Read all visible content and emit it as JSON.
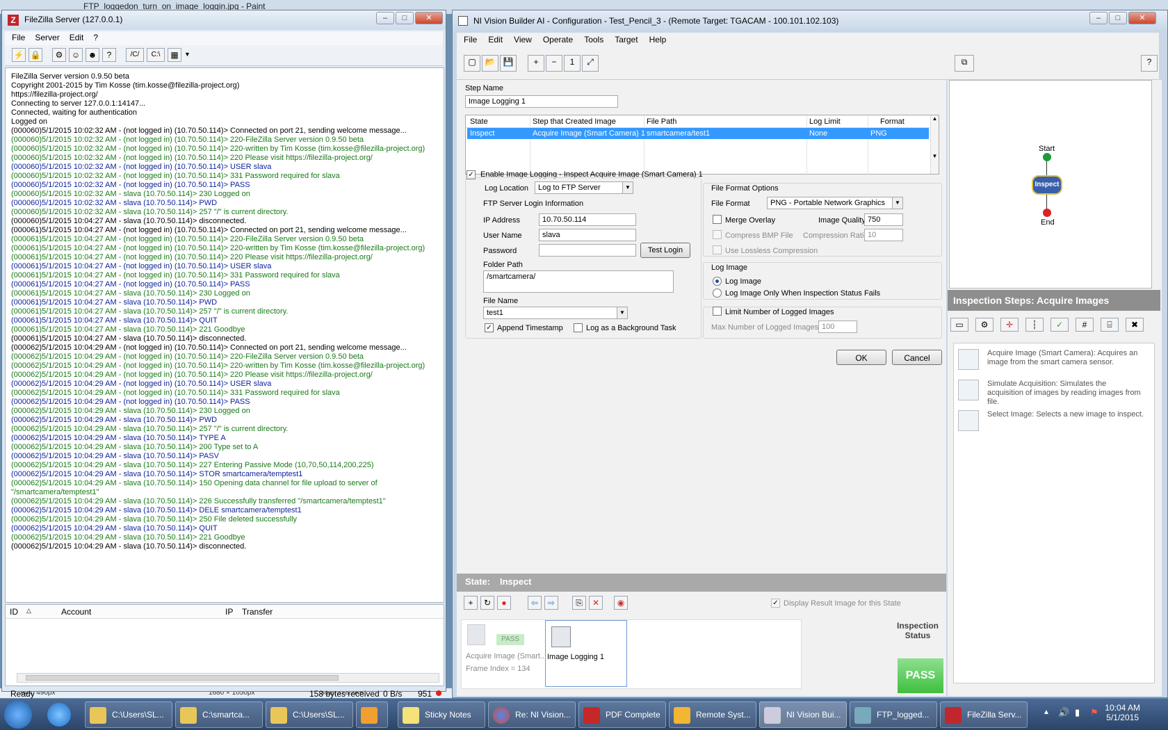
{
  "paint": {
    "title": "FTP_loggedon_turn_on_image_loggin.jpg - Paint",
    "status_left": "644, 490px",
    "status_mid": "1680 × 1050px",
    "status_right": "Size: 378.2KB"
  },
  "filezilla": {
    "title": "FileZilla Server (127.0.0.1)",
    "menu": [
      "File",
      "Server",
      "Edit",
      "?"
    ],
    "toolbar_paths": [
      "/C/",
      "C:\\"
    ],
    "log": [
      {
        "t": "FileZilla Server version 0.9.50 beta",
        "c": "black"
      },
      {
        "t": "Copyright 2001-2015 by Tim Kosse (tim.kosse@filezilla-project.org)",
        "c": "black"
      },
      {
        "t": "https://filezilla-project.org/",
        "c": "black"
      },
      {
        "t": "Connecting to server 127.0.0.1:14147...",
        "c": "black"
      },
      {
        "t": "Connected, waiting for authentication",
        "c": "black"
      },
      {
        "t": "Logged on",
        "c": "black"
      },
      {
        "t": "(000060)5/1/2015 10:02:32 AM - (not logged in) (10.70.50.114)> Connected on port 21, sending welcome message...",
        "c": "black"
      },
      {
        "t": "(000060)5/1/2015 10:02:32 AM - (not logged in) (10.70.50.114)> 220-FileZilla Server version 0.9.50 beta",
        "c": "green"
      },
      {
        "t": "(000060)5/1/2015 10:02:32 AM - (not logged in) (10.70.50.114)> 220-written by Tim Kosse (tim.kosse@filezilla-project.org)",
        "c": "green"
      },
      {
        "t": "(000060)5/1/2015 10:02:32 AM - (not logged in) (10.70.50.114)> 220 Please visit https://filezilla-project.org/",
        "c": "green"
      },
      {
        "t": "(000060)5/1/2015 10:02:32 AM - (not logged in) (10.70.50.114)> USER slava",
        "c": "blue"
      },
      {
        "t": "(000060)5/1/2015 10:02:32 AM - (not logged in) (10.70.50.114)> 331 Password required for slava",
        "c": "green"
      },
      {
        "t": "(000060)5/1/2015 10:02:32 AM - (not logged in) (10.70.50.114)> PASS",
        "c": "blue"
      },
      {
        "t": "(000060)5/1/2015 10:02:32 AM - slava (10.70.50.114)> 230 Logged on",
        "c": "green"
      },
      {
        "t": "(000060)5/1/2015 10:02:32 AM - slava (10.70.50.114)> PWD",
        "c": "blue"
      },
      {
        "t": "(000060)5/1/2015 10:02:32 AM - slava (10.70.50.114)> 257 \"/\" is current directory.",
        "c": "green"
      },
      {
        "t": "(000060)5/1/2015 10:04:27 AM - slava (10.70.50.114)> disconnected.",
        "c": "black"
      },
      {
        "t": "(000061)5/1/2015 10:04:27 AM - (not logged in) (10.70.50.114)> Connected on port 21, sending welcome message...",
        "c": "black"
      },
      {
        "t": "(000061)5/1/2015 10:04:27 AM - (not logged in) (10.70.50.114)> 220-FileZilla Server version 0.9.50 beta",
        "c": "green"
      },
      {
        "t": "(000061)5/1/2015 10:04:27 AM - (not logged in) (10.70.50.114)> 220-written by Tim Kosse (tim.kosse@filezilla-project.org)",
        "c": "green"
      },
      {
        "t": "(000061)5/1/2015 10:04:27 AM - (not logged in) (10.70.50.114)> 220 Please visit https://filezilla-project.org/",
        "c": "green"
      },
      {
        "t": "(000061)5/1/2015 10:04:27 AM - (not logged in) (10.70.50.114)> USER slava",
        "c": "blue"
      },
      {
        "t": "(000061)5/1/2015 10:04:27 AM - (not logged in) (10.70.50.114)> 331 Password required for slava",
        "c": "green"
      },
      {
        "t": "(000061)5/1/2015 10:04:27 AM - (not logged in) (10.70.50.114)> PASS",
        "c": "blue"
      },
      {
        "t": "(000061)5/1/2015 10:04:27 AM - slava (10.70.50.114)> 230 Logged on",
        "c": "green"
      },
      {
        "t": "(000061)5/1/2015 10:04:27 AM - slava (10.70.50.114)> PWD",
        "c": "blue"
      },
      {
        "t": "(000061)5/1/2015 10:04:27 AM - slava (10.70.50.114)> 257 \"/\" is current directory.",
        "c": "green"
      },
      {
        "t": "(000061)5/1/2015 10:04:27 AM - slava (10.70.50.114)> QUIT",
        "c": "blue"
      },
      {
        "t": "(000061)5/1/2015 10:04:27 AM - slava (10.70.50.114)> 221 Goodbye",
        "c": "green"
      },
      {
        "t": "(000061)5/1/2015 10:04:27 AM - slava (10.70.50.114)> disconnected.",
        "c": "black"
      },
      {
        "t": "(000062)5/1/2015 10:04:29 AM - (not logged in) (10.70.50.114)> Connected on port 21, sending welcome message...",
        "c": "black"
      },
      {
        "t": "(000062)5/1/2015 10:04:29 AM - (not logged in) (10.70.50.114)> 220-FileZilla Server version 0.9.50 beta",
        "c": "green"
      },
      {
        "t": "(000062)5/1/2015 10:04:29 AM - (not logged in) (10.70.50.114)> 220-written by Tim Kosse (tim.kosse@filezilla-project.org)",
        "c": "green"
      },
      {
        "t": "(000062)5/1/2015 10:04:29 AM - (not logged in) (10.70.50.114)> 220 Please visit https://filezilla-project.org/",
        "c": "green"
      },
      {
        "t": "(000062)5/1/2015 10:04:29 AM - (not logged in) (10.70.50.114)> USER slava",
        "c": "blue"
      },
      {
        "t": "(000062)5/1/2015 10:04:29 AM - (not logged in) (10.70.50.114)> 331 Password required for slava",
        "c": "green"
      },
      {
        "t": "(000062)5/1/2015 10:04:29 AM - (not logged in) (10.70.50.114)> PASS",
        "c": "blue"
      },
      {
        "t": "(000062)5/1/2015 10:04:29 AM - slava (10.70.50.114)> 230 Logged on",
        "c": "green"
      },
      {
        "t": "(000062)5/1/2015 10:04:29 AM - slava (10.70.50.114)> PWD",
        "c": "blue"
      },
      {
        "t": "(000062)5/1/2015 10:04:29 AM - slava (10.70.50.114)> 257 \"/\" is current directory.",
        "c": "green"
      },
      {
        "t": "(000062)5/1/2015 10:04:29 AM - slava (10.70.50.114)> TYPE A",
        "c": "blue"
      },
      {
        "t": "(000062)5/1/2015 10:04:29 AM - slava (10.70.50.114)> 200 Type set to A",
        "c": "green"
      },
      {
        "t": "(000062)5/1/2015 10:04:29 AM - slava (10.70.50.114)> PASV",
        "c": "blue"
      },
      {
        "t": "(000062)5/1/2015 10:04:29 AM - slava (10.70.50.114)> 227 Entering Passive Mode (10,70,50,114,200,225)",
        "c": "green"
      },
      {
        "t": "(000062)5/1/2015 10:04:29 AM - slava (10.70.50.114)> STOR smartcamera/temptest1",
        "c": "blue"
      },
      {
        "t": "(000062)5/1/2015 10:04:29 AM - slava (10.70.50.114)> 150 Opening data channel for file upload to server of",
        "c": "green"
      },
      {
        "t": "    \"/smartcamera/temptest1\"",
        "c": "green"
      },
      {
        "t": "(000062)5/1/2015 10:04:29 AM - slava (10.70.50.114)> 226 Successfully transferred \"/smartcamera/temptest1\"",
        "c": "green"
      },
      {
        "t": "(000062)5/1/2015 10:04:29 AM - slava (10.70.50.114)> DELE smartcamera/temptest1",
        "c": "blue"
      },
      {
        "t": "(000062)5/1/2015 10:04:29 AM - slava (10.70.50.114)> 250 File deleted successfully",
        "c": "green"
      },
      {
        "t": "(000062)5/1/2015 10:04:29 AM - slava (10.70.50.114)> QUIT",
        "c": "blue"
      },
      {
        "t": "(000062)5/1/2015 10:04:29 AM - slava (10.70.50.114)> 221 Goodbye",
        "c": "green"
      },
      {
        "t": "(000062)5/1/2015 10:04:29 AM - slava (10.70.50.114)> disconnected.",
        "c": "black"
      }
    ],
    "table_headers": {
      "id": "ID",
      "account": "Account",
      "ip": "IP",
      "transfer": "Transfer"
    },
    "status": {
      "ready": "Ready",
      "received": "158 bytes received",
      "rate": "0 B/s",
      "count": "951"
    }
  },
  "ni": {
    "title": "NI Vision Builder AI - Configuration - Test_Pencil_3 - (Remote Target: TGACAM - 100.101.102.103)",
    "menu": [
      "File",
      "Edit",
      "View",
      "Operate",
      "Tools",
      "Target",
      "Help"
    ],
    "step_name_label": "Step Name",
    "step_name_value": "Image Logging 1",
    "grid_headers": {
      "state": "State",
      "step": "Step that Created Image",
      "path": "File Path",
      "limit": "Log Limit",
      "format": "Format"
    },
    "grid_row": {
      "state": "Inspect",
      "step": "Acquire Image (Smart Camera) 1",
      "path": "smartcamera/test1",
      "limit": "None",
      "format": "PNG"
    },
    "enable_logging": "Enable Image Logging - Inspect Acquire Image (Smart Camera) 1",
    "log_location_label": "Log Location",
    "log_location_value": "Log to FTP Server",
    "ftp_login_label": "FTP Server Login Information",
    "ip_label": "IP Address",
    "ip_value": "10.70.50.114",
    "user_label": "User Name",
    "user_value": "slava",
    "password_label": "Password",
    "password_value": "",
    "test_login": "Test Login",
    "folder_label": "Folder Path",
    "folder_value": "/smartcamera/",
    "file_name_label": "File Name",
    "file_name_value": "test1",
    "append_timestamp": "Append Timestamp",
    "log_background": "Log as a Background Task",
    "file_format_options": "File Format Options",
    "file_format_label": "File Format",
    "file_format_value": "PNG - Portable Network Graphics",
    "merge_overlay": "Merge Overlay",
    "image_quality_label": "Image Quality",
    "image_quality_value": "750",
    "compress_bmp": "Compress BMP File",
    "compression_ratio_label": "Compression Ratio",
    "compression_ratio_value": "10",
    "lossless": "Use Lossless Compression",
    "log_image_group": "Log Image",
    "log_image_opt": "Log Image",
    "log_only_fail_opt": "Log Image Only When Inspection Status Fails",
    "limit_logged": "Limit Number of Logged Images",
    "max_logged_label": "Max Number of Logged Images",
    "max_logged_value": "100",
    "ok": "OK",
    "cancel": "Cancel",
    "state_label": "State:",
    "state_value": "Inspect",
    "display_result": "Display Result Image for this State",
    "step1_name": "Acquire Image (Smart...",
    "step1_badge": "PASS",
    "step1_frame": "Frame Index = 134",
    "step2_name": "Image Logging 1",
    "inspection_status_label": "Inspection\nStatus",
    "inspection_status_value": "PASS",
    "diagram": {
      "start": "Start",
      "inspect": "Inspect",
      "end": "End"
    },
    "inspection_steps_title": "Inspection Steps: Acquire Images",
    "steps": [
      {
        "text": "Acquire Image (Smart Camera):  Acquires an image from the smart camera sensor."
      },
      {
        "text": "Simulate Acquisition:  Simulates the acquisition of images by reading images from file."
      },
      {
        "text": "Select Image:  Selects a new image to inspect."
      }
    ]
  },
  "taskbar": {
    "items": [
      "C:\\Users\\SL...",
      "C:\\smartca...",
      "C:\\Users\\SL...",
      "",
      "Sticky Notes",
      "Re: NI Vision...",
      "PDF Complete",
      "Remote Syst...",
      "NI Vision Bui...",
      "FTP_logged...",
      "FileZilla Serv..."
    ],
    "time": "10:04 AM",
    "date": "5/1/2015"
  },
  "colors": {
    "green_log": "#187a18",
    "blue_log": "#0a1f9c",
    "pass": "#3fbf3f",
    "selection": "#3399ff"
  }
}
